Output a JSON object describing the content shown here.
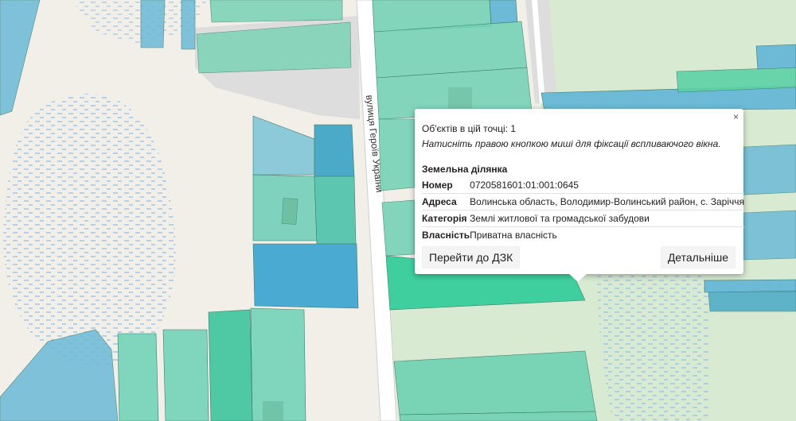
{
  "map": {
    "street_name": "вулиця Героїв України"
  },
  "popup": {
    "close_label": "×",
    "objects_count": "Об'єктів в цій точці: 1",
    "hint": "Натисніть правою кнопкою миші для фіксації вспливаючого вікна.",
    "title": "Земельна ділянка",
    "rows": [
      {
        "key": "Номер",
        "value": "0720581601:01:001:0645"
      },
      {
        "key": "Адреса",
        "value": "Волинська область, Володимир-Волинський район, с. Заріччя"
      },
      {
        "key": "Категорія",
        "value": "Землі житлової та громадської забудови"
      },
      {
        "key": "Власність",
        "value": "Приватна власність"
      }
    ],
    "buttons": {
      "dzk": "Перейти до ДЗК",
      "details": "Детальніше"
    }
  },
  "colors": {
    "background": "#f2efe9",
    "farmland": "#d9ead2",
    "road": "#ffffff",
    "parcel_teal": "#6fd1b2",
    "parcel_blue": "#6cbad6",
    "wetland_pattern": "#9cc2e8"
  }
}
